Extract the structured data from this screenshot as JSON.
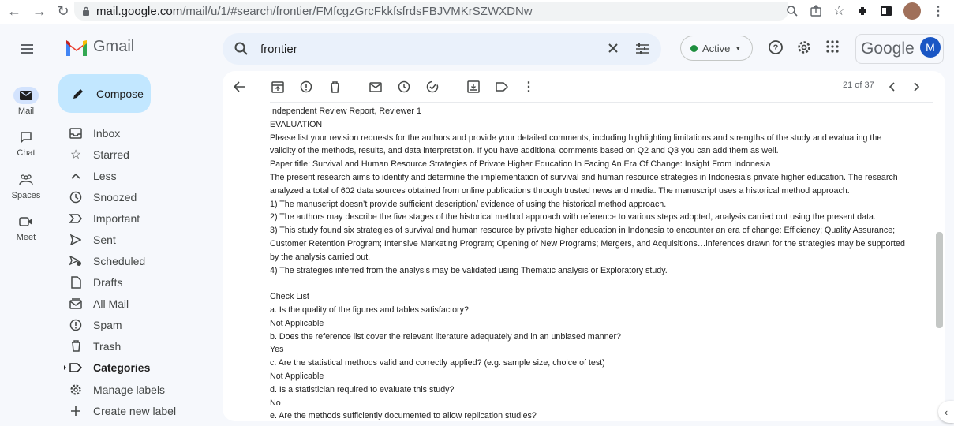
{
  "browser": {
    "url_host": "mail.google.com",
    "url_path": "/mail/u/1/#search/frontier/FMfcgzGrcFkkfsfrdsFBJVMKrSZWXDNw"
  },
  "header": {
    "app_name": "Gmail",
    "search_value": "frontier",
    "status_label": "Active",
    "brand_word": "Google",
    "avatar_letter": "M"
  },
  "rail": [
    {
      "label": "Mail"
    },
    {
      "label": "Chat"
    },
    {
      "label": "Spaces"
    },
    {
      "label": "Meet"
    }
  ],
  "compose_label": "Compose",
  "nav": {
    "inbox": "Inbox",
    "starred": "Starred",
    "less": "Less",
    "snoozed": "Snoozed",
    "important": "Important",
    "sent": "Sent",
    "scheduled": "Scheduled",
    "drafts": "Drafts",
    "all_mail": "All Mail",
    "spam": "Spam",
    "trash": "Trash",
    "categories": "Categories",
    "manage_labels": "Manage labels",
    "create_label": "Create new label"
  },
  "toolbar": {
    "pager": "21 of 37"
  },
  "message": {
    "lines": [
      "Independent Review Report, Reviewer 1",
      "EVALUATION",
      "Please list your revision requests for the authors and provide your detailed comments, including highlighting limitations and strengths of the study and evaluating the",
      "validity of the methods, results, and data interpretation. If you have additional comments based on Q2 and Q3 you can add them as well.",
      "Paper title: Survival and Human Resource Strategies of Private Higher Education In Facing An Era Of Change: Insight From Indonesia",
      "The present research aims to identify and determine the implementation of survival and human resource strategies in Indonesia’s private higher education. The research",
      "analyzed a total of 602 data sources obtained from online publications through trusted news and media. The manuscript uses a historical method approach.",
      "1) The manuscript doesn’t provide sufficient description/ evidence of using the historical method approach.",
      "2) The authors may describe the five stages of the historical method approach with reference to various steps adopted, analysis carried out using the present data.",
      "3) This study found six strategies of survival and human resource by private higher education in Indonesia to encounter an era of change: Efficiency; Quality Assurance;",
      "Customer Retention Program; Intensive Marketing Program; Opening of New Programs; Mergers, and Acquisitions…inferences drawn for the strategies may be supported",
      "by the analysis carried out.",
      "4) The strategies inferred from the analysis may be validated using Thematic analysis or Exploratory study.",
      "",
      "Check List",
      "a. Is the quality of the figures and tables satisfactory?",
      "Not Applicable",
      "b. Does the reference list cover the relevant literature adequately and in an unbiased manner?",
      "Yes",
      "c. Are the statistical methods valid and correctly applied? (e.g. sample size, choice of test)",
      "Not Applicable",
      "d. Is a statistician required to evaluate this study?",
      "No",
      "e. Are the methods sufficiently documented to allow replication studies?"
    ]
  },
  "colors": {
    "compose_bg": "#c2e7ff",
    "search_bg": "#eaf1fb",
    "active_green": "#1e8e3e",
    "avatar_blue": "#1a56c4"
  }
}
